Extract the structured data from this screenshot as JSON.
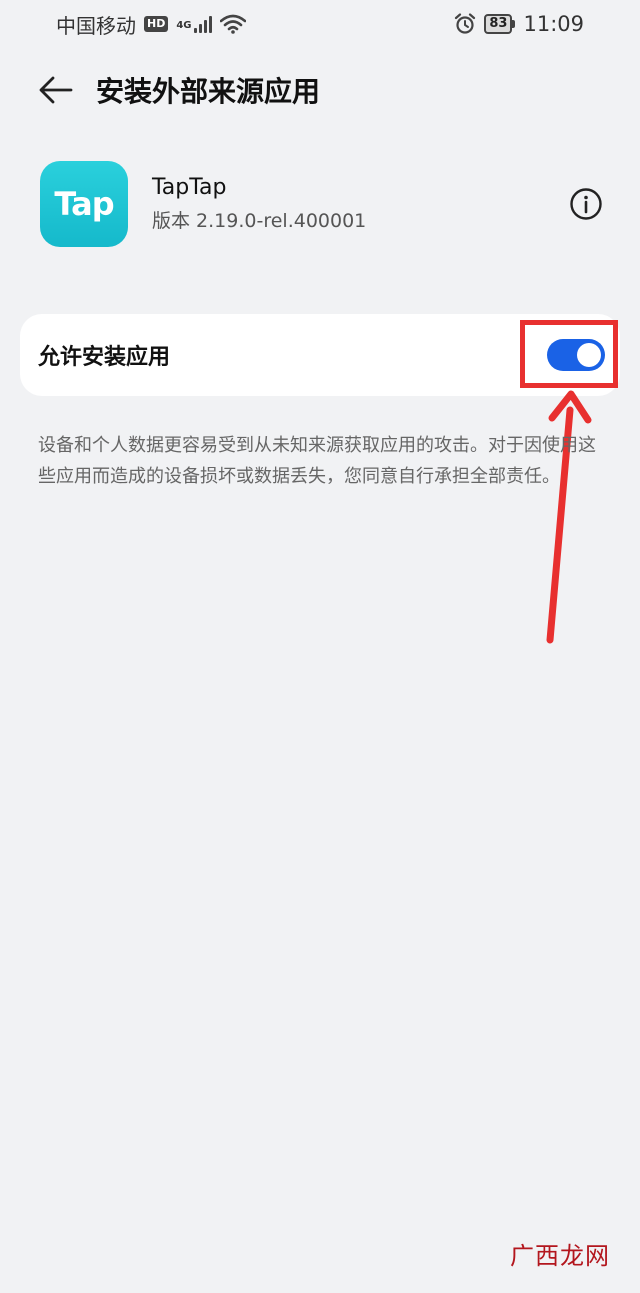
{
  "status_bar": {
    "carrier": "中国移动",
    "hd_badge": "HD",
    "network": "4G",
    "battery_level": "83",
    "time": "11:09"
  },
  "header": {
    "title": "安装外部来源应用"
  },
  "app": {
    "icon_text": "Tap",
    "name": "TapTap",
    "version": "版本 2.19.0-rel.400001"
  },
  "setting": {
    "label": "允许安装应用",
    "enabled": true
  },
  "warning": "设备和个人数据更容易受到从未知来源获取应用的攻击。对于因使用这些应用而造成的设备损坏或数据丢失，您同意自行承担全部责任。",
  "watermark": "广西龙网",
  "colors": {
    "toggle_on": "#1a62e6",
    "app_icon": "#1cc3d2",
    "annotation": "#e8302f"
  }
}
